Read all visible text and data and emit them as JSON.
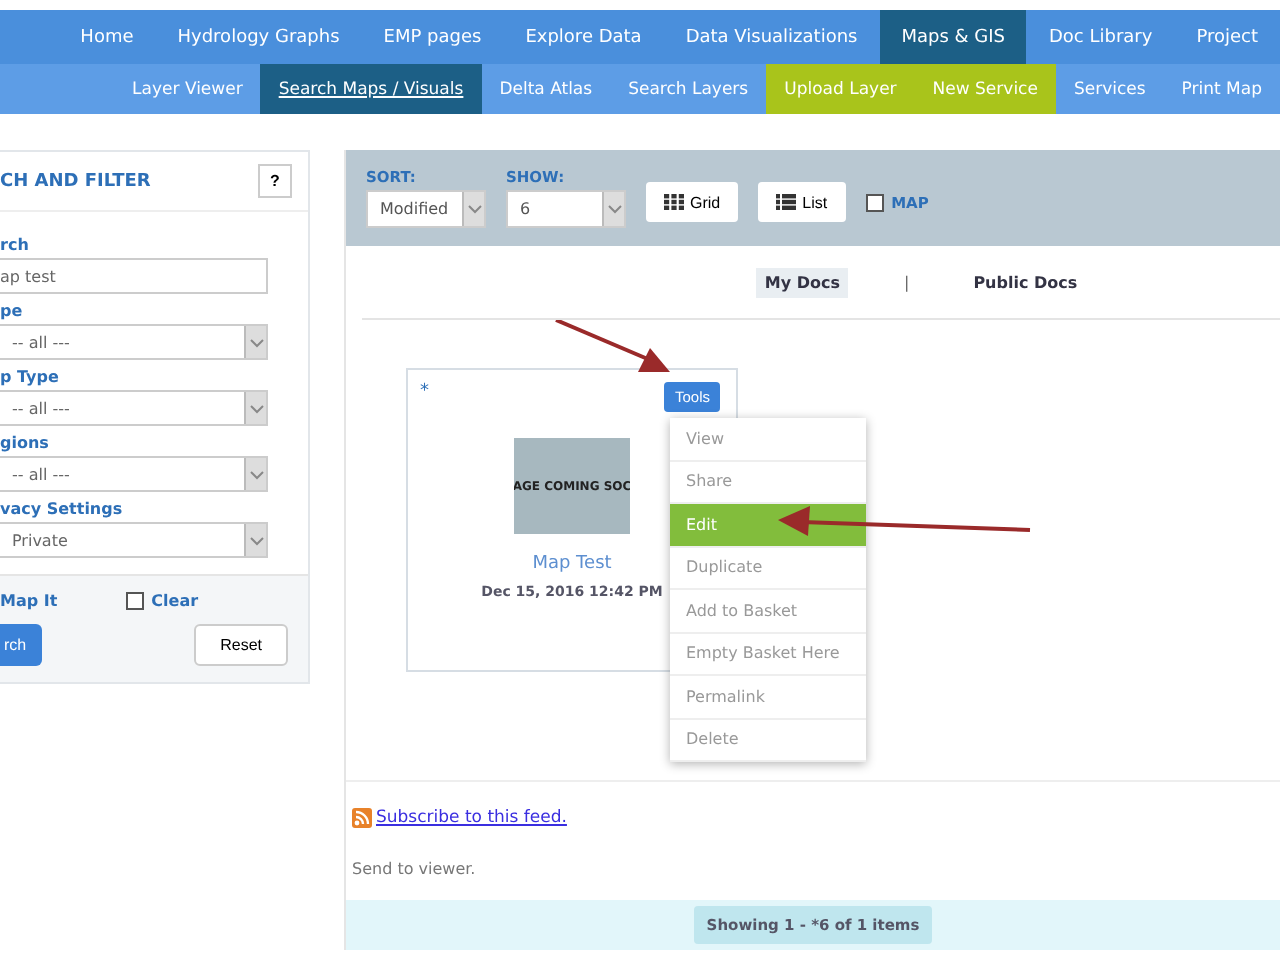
{
  "main_nav": [
    {
      "label": "Home",
      "selected": false
    },
    {
      "label": "Hydrology Graphs",
      "selected": false
    },
    {
      "label": "EMP pages",
      "selected": false
    },
    {
      "label": "Explore Data",
      "selected": false
    },
    {
      "label": "Data Visualizations",
      "selected": false
    },
    {
      "label": "Maps & GIS",
      "selected": true
    },
    {
      "label": "Doc Library",
      "selected": false
    },
    {
      "label": "Project",
      "selected": false
    }
  ],
  "sub_nav": [
    {
      "label": "Layer Viewer",
      "selected": false,
      "kind": "plain"
    },
    {
      "label": "Search Maps / Visuals",
      "selected": true,
      "kind": "plain"
    },
    {
      "label": "Delta Atlas",
      "selected": false,
      "kind": "plain"
    },
    {
      "label": "Search Layers",
      "selected": false,
      "kind": "plain"
    },
    {
      "label": "Upload Layer",
      "selected": false,
      "kind": "highlight"
    },
    {
      "label": "New Service",
      "selected": false,
      "kind": "highlight"
    },
    {
      "label": "Services",
      "selected": false,
      "kind": "plain"
    },
    {
      "label": "Print Map",
      "selected": false,
      "kind": "plain"
    }
  ],
  "filter_panel": {
    "title": "CH AND FILTER",
    "help": "?",
    "fields": [
      {
        "label": "rch",
        "kind": "text",
        "value": "ap test"
      },
      {
        "label": "pe",
        "kind": "select",
        "value": "-- all ---"
      },
      {
        "label": "p Type",
        "kind": "select",
        "value": "-- all ---"
      },
      {
        "label": "gions",
        "kind": "select",
        "value": "-- all ---"
      },
      {
        "label": "vacy Settings",
        "kind": "select",
        "value": "Private"
      }
    ],
    "map_it": "Map It",
    "clear": {
      "label": "Clear",
      "checked": false
    },
    "search_button": "rch",
    "reset_button": "Reset"
  },
  "toolbar": {
    "sort": {
      "label": "SORT:",
      "value": "Modified"
    },
    "show": {
      "label": "SHOW:",
      "value": "6"
    },
    "grid_button": "Grid",
    "list_button": "List",
    "map": {
      "label": "MAP",
      "checked": false
    }
  },
  "doc_tabs": [
    {
      "label": "My Docs",
      "selected": true
    },
    {
      "label": "Public Docs",
      "selected": false
    }
  ],
  "doc_tabs_separator": "|",
  "card": {
    "star": "*",
    "tools_button": "Tools",
    "image_caption": "AGE COMING SOC",
    "title": "Map Test",
    "date": "Dec 15, 2016 12:42 PM"
  },
  "tools_menu": [
    {
      "label": "View",
      "selected": false
    },
    {
      "label": "Share",
      "selected": false
    },
    {
      "label": "Edit",
      "selected": true
    },
    {
      "label": "Duplicate",
      "selected": false
    },
    {
      "label": "Add to Basket",
      "selected": false
    },
    {
      "label": "Empty Basket Here",
      "selected": false
    },
    {
      "label": "Permalink",
      "selected": false
    },
    {
      "label": "Delete",
      "selected": false
    }
  ],
  "subscribe_link": "Subscribe to this feed.",
  "send_text": "Send to viewer.",
  "pager": "Showing 1 - *6 of 1 items"
}
